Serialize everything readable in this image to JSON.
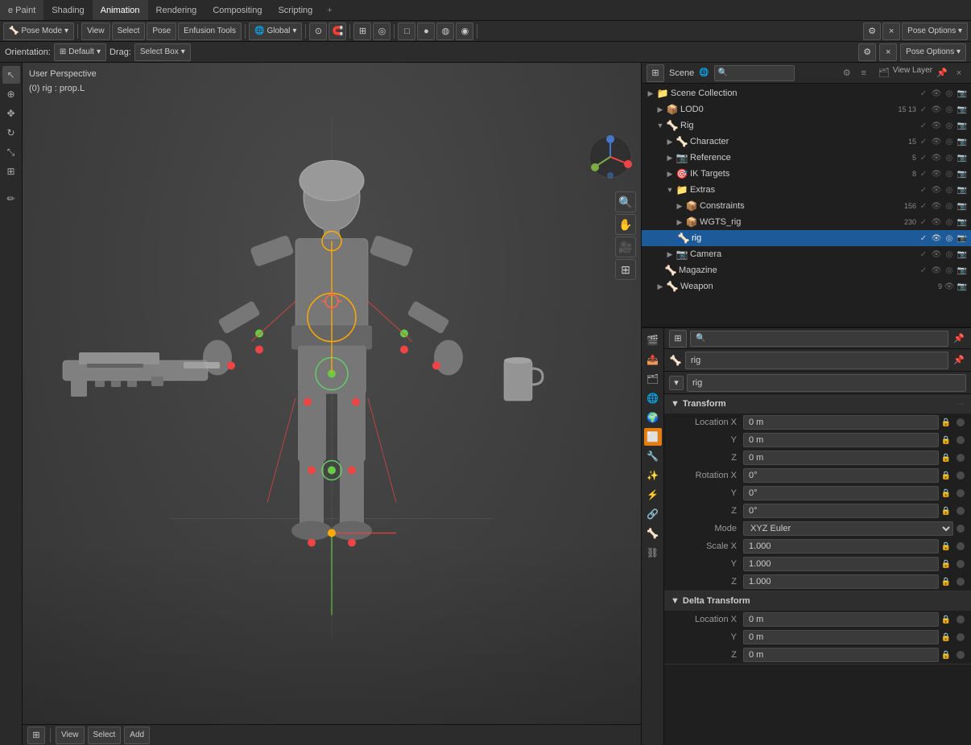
{
  "menus": {
    "items": [
      "e Paint",
      "Shading",
      "Animation",
      "Rendering",
      "Compositing",
      "Scripting"
    ]
  },
  "toolbar2": {
    "mode": "Pose Mode",
    "view": "View",
    "select": "Select",
    "pose": "Pose",
    "custom": "Enfusion Tools",
    "transform": "Global",
    "proportional": "",
    "snap": "",
    "overlay": "",
    "xray": "",
    "shading_options": [
      "Wireframe",
      "Solid",
      "Material",
      "Rendered"
    ],
    "pose_options": "Pose Options"
  },
  "toolbar3": {
    "orientation_label": "Orientation:",
    "orientation_value": "Default",
    "drag_label": "Drag:",
    "drag_value": "Select Box"
  },
  "viewport": {
    "perspective": "User Perspective",
    "rig_info": "(0) rig : prop.L"
  },
  "gizmo": {
    "x_color": "#ee4444",
    "y_color": "#7aad44",
    "z_color": "#4477cc"
  },
  "outliner": {
    "title": "Scene",
    "view_layer": "View Layer",
    "search_placeholder": "Search...",
    "items": [
      {
        "id": "scene_collection",
        "label": "Scene Collection",
        "level": 0,
        "icon": "📁",
        "arrow": "▶",
        "has_arrow": false,
        "count": ""
      },
      {
        "id": "lod0",
        "label": "LOD0",
        "level": 1,
        "icon": "📦",
        "arrow": "▶",
        "has_arrow": true,
        "count": "15 13"
      },
      {
        "id": "rig",
        "label": "Rig",
        "level": 1,
        "icon": "🦴",
        "arrow": "▼",
        "has_arrow": true,
        "count": ""
      },
      {
        "id": "character",
        "label": "Character",
        "level": 2,
        "icon": "🦴",
        "arrow": "▶",
        "has_arrow": true,
        "count": "15"
      },
      {
        "id": "reference",
        "label": "Reference",
        "level": 2,
        "icon": "📷",
        "arrow": "▶",
        "has_arrow": true,
        "count": "5"
      },
      {
        "id": "ik_targets",
        "label": "IK Targets",
        "level": 2,
        "icon": "🎯",
        "arrow": "▶",
        "has_arrow": true,
        "count": "8"
      },
      {
        "id": "extras",
        "label": "Extras",
        "level": 2,
        "icon": "📁",
        "arrow": "▼",
        "has_arrow": true,
        "count": ""
      },
      {
        "id": "constraints",
        "label": "Constraints",
        "level": 3,
        "icon": "📦",
        "arrow": "▶",
        "has_arrow": true,
        "count": "156"
      },
      {
        "id": "wgts_rig",
        "label": "WGTS_rig",
        "level": 3,
        "icon": "📦",
        "arrow": "▶",
        "has_arrow": true,
        "count": "230"
      },
      {
        "id": "rig_obj",
        "label": "rig",
        "level": 3,
        "icon": "🦴",
        "arrow": "",
        "has_arrow": false,
        "count": "",
        "selected": true
      },
      {
        "id": "camera",
        "label": "Camera",
        "level": 2,
        "icon": "📷",
        "arrow": "▶",
        "has_arrow": true,
        "count": ""
      },
      {
        "id": "magazine",
        "label": "Magazine",
        "level": 2,
        "icon": "🦴",
        "arrow": "",
        "has_arrow": false,
        "count": ""
      },
      {
        "id": "weapon",
        "label": "Weapon",
        "level": 1,
        "icon": "🦴",
        "arrow": "▶",
        "has_arrow": true,
        "count": "9"
      }
    ]
  },
  "properties": {
    "search_placeholder": "Search...",
    "active_object": "rig",
    "object_name": "rig",
    "sections": {
      "transform": {
        "title": "Transform",
        "location": {
          "x": "0 m",
          "y": "0 m",
          "z": "0 m"
        },
        "rotation": {
          "x": "0°",
          "y": "0°",
          "z": "0°",
          "mode": "XYZ Euler"
        },
        "scale": {
          "x": "1.000",
          "y": "1.000",
          "z": "1.000"
        }
      },
      "delta_transform": {
        "title": "Delta Transform",
        "location": {
          "x": "0 m",
          "y": "0 m",
          "z": "0 m"
        }
      }
    }
  },
  "left_sidebar": {
    "icons": [
      "⊞",
      "✥",
      "↔",
      "↩",
      "🔍",
      "📐",
      "✂",
      "⊕",
      "🔧",
      "⚙"
    ]
  },
  "viewport_right": {
    "icons": [
      "🔍",
      "✋",
      "🎥",
      "📐"
    ]
  },
  "props_sidebar": {
    "icons": [
      "⚡",
      "🎬",
      "🎯",
      "🔧",
      "📊",
      "🔩",
      "⚙",
      "🌐",
      "🎭"
    ]
  }
}
